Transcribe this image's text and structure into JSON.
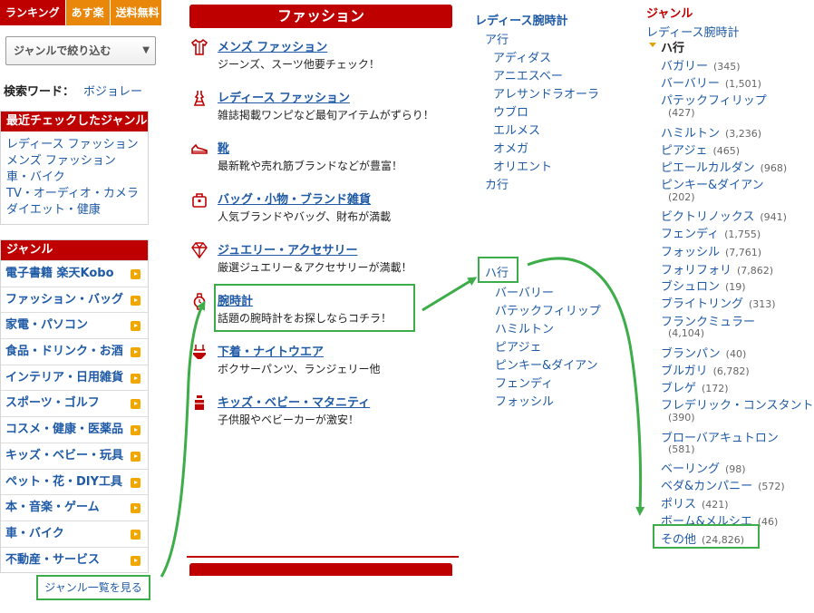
{
  "tabs": [
    "ランキング",
    "あす楽",
    "送料無料"
  ],
  "genre_select": "ジャンルで絞り込む",
  "keyword": {
    "label": "検索ワード：",
    "value": "ボジョレー"
  },
  "recent": {
    "header": "最近チェックしたジャンル",
    "items": [
      "レディース ファッション",
      "メンズ ファッション",
      "車・バイク",
      "TV・オーディオ・カメラ",
      "ダイエット・健康"
    ]
  },
  "genres": {
    "header": "ジャンル",
    "items": [
      "電子書籍 楽天Kobo",
      "ファッション・バッグ",
      "家電・パソコン",
      "食品・ドリンク・お酒",
      "インテリア・日用雑貨",
      "スポーツ・ゴルフ",
      "コスメ・健康・医薬品",
      "キッズ・ベビー・玩具",
      "ペット・花・DIY工具",
      "本・音楽・ゲーム",
      "車・バイク",
      "不動産・サービス"
    ],
    "see_all": "ジャンル一覧を見る"
  },
  "fashion": {
    "header": "ファッション",
    "categories": [
      {
        "title": "メンズ ファッション",
        "desc": "ジーンズ、スーツ他要チェック！",
        "icon": "shirt-icon"
      },
      {
        "title": "レディース ファッション",
        "desc": "雑誌掲載ワンピなど最旬アイテムがずらり！",
        "icon": "dress-icon"
      },
      {
        "title": "靴",
        "desc": "最新靴や売れ筋ブランドなどが豊富！",
        "icon": "shoe-icon"
      },
      {
        "title": "バッグ・小物・ブランド雑貨",
        "desc": "人気ブランドやバッグ、財布が満載",
        "icon": "bag-icon"
      },
      {
        "title": "ジュエリー・アクセサリー",
        "desc": "厳選ジュエリー＆アクセサリーが満載！",
        "icon": "diamond-icon"
      },
      {
        "title": "腕時計",
        "desc": "話題の腕時計をお探しならコチラ！",
        "icon": "watch-icon"
      },
      {
        "title": "下着・ナイトウエア",
        "desc": "ボクサーパンツ、ランジェリー他",
        "icon": "underwear-icon"
      },
      {
        "title": "キッズ・ベビー・マタニティ",
        "desc": "子供服やベビーカーが激安！",
        "icon": "kids-icon"
      }
    ]
  },
  "ladies_watch": {
    "header": "レディース腕時計",
    "a_row": "ア行",
    "a_items": [
      "アディダス",
      "アニエスベー",
      "アレサンドラオーラ",
      "ウブロ",
      "エルメス",
      "オメガ",
      "オリエント"
    ],
    "ka_row": "カ行",
    "ha_row": "ハ行",
    "ha_items": [
      "バーバリー",
      "パテックフィリップ",
      "ハミルトン",
      "ピアジェ",
      "ピンキー&ダイアン",
      "フェンディ",
      "フォッシル"
    ]
  },
  "right": {
    "genre_label": "ジャンル",
    "breadcrumb": "レディース腕時計",
    "section": "ハ行",
    "brands": [
      {
        "name": "バガリー",
        "count": "(345)"
      },
      {
        "name": "バーバリー",
        "count": "(1,501)"
      },
      {
        "name": "パテックフィリップ",
        "count": "(427)"
      },
      {
        "name": "ハミルトン",
        "count": "(3,236)"
      },
      {
        "name": "ピアジェ",
        "count": "(465)"
      },
      {
        "name": "ピエールカルダン",
        "count": "(968)"
      },
      {
        "name": "ピンキー&ダイアン",
        "count": "(202)"
      },
      {
        "name": "ビクトリノックス",
        "count": "(941)"
      },
      {
        "name": "フェンディ",
        "count": "(1,755)"
      },
      {
        "name": "フォッシル",
        "count": "(7,761)"
      },
      {
        "name": "フォリフォリ",
        "count": "(7,862)"
      },
      {
        "name": "ブシュロン",
        "count": "(19)"
      },
      {
        "name": "ブライトリング",
        "count": "(313)"
      },
      {
        "name": "フランクミュラー",
        "count": "(4,104)"
      },
      {
        "name": "ブランパン",
        "count": "(40)"
      },
      {
        "name": "ブルガリ",
        "count": "(6,782)"
      },
      {
        "name": "ブレゲ",
        "count": "(172)"
      },
      {
        "name": "フレデリック・コンスタント",
        "count": "(390)"
      },
      {
        "name": "ブローバアキュトロン",
        "count": "(581)"
      },
      {
        "name": "ベーリング",
        "count": "(98)"
      },
      {
        "name": "ベダ&カンパニー",
        "count": "(572)"
      },
      {
        "name": "ポリス",
        "count": "(421)"
      },
      {
        "name": "ボーム&メルシエ",
        "count": "(46)"
      },
      {
        "name": "その他",
        "count": "(24,826)"
      }
    ]
  }
}
